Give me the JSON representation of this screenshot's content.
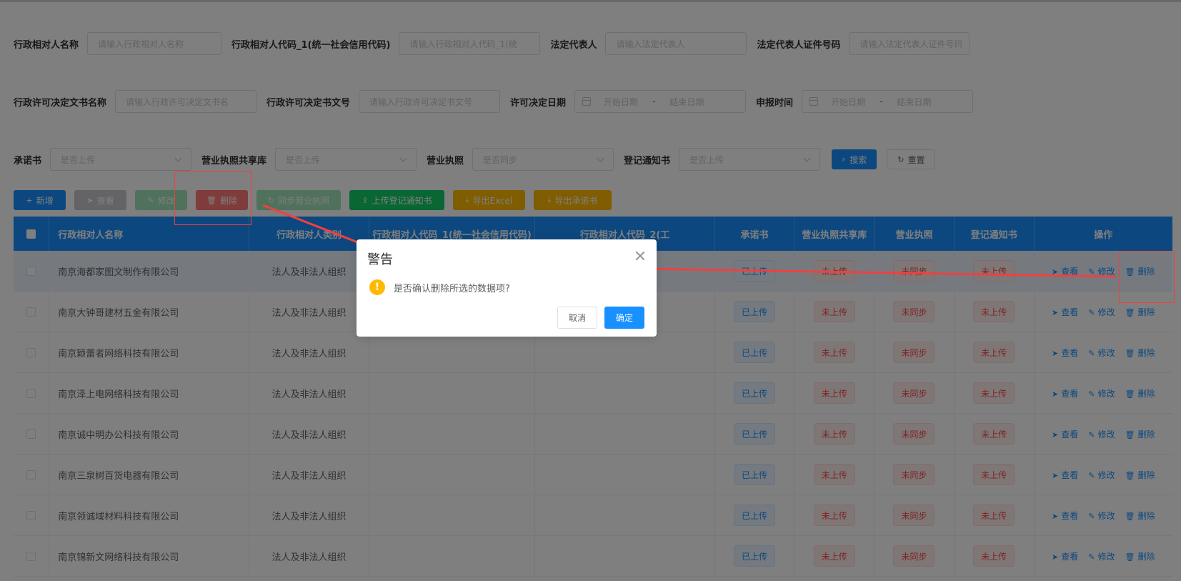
{
  "search_form": {
    "row1": [
      {
        "label": "行政相对人名称",
        "placeholder": "请输入行政相对人名称"
      },
      {
        "label": "行政相对人代码_1(统一社会信用代码)",
        "placeholder": "请输入行政相对人代码_1(统"
      },
      {
        "label": "法定代表人",
        "placeholder": "请输入法定代表人"
      },
      {
        "label": "法定代表人证件号码",
        "placeholder": "请输入法定代表人证件号码"
      }
    ],
    "row2": {
      "doc_name_label": "行政许可决定文书名称",
      "doc_name_placeholder": "请输入行政许可决定文书名",
      "doc_no_label": "行政许可决定书文号",
      "doc_no_placeholder": "请输入行政许可决定书文号",
      "decision_date_label": "许可决定日期",
      "report_time_label": "申报时间",
      "start_placeholder": "开始日期",
      "end_placeholder": "结束日期",
      "range_separator": "-"
    },
    "row3": {
      "commitment_label": "承诺书",
      "commitment_value": "是否上传",
      "shared_label": "营业执照共享库",
      "shared_value": "是否上传",
      "license_label": "营业执照",
      "license_value": "是否同步",
      "notice_label": "登记通知书",
      "notice_value": "是否上传",
      "search_btn": "搜索",
      "reset_btn": "重置"
    }
  },
  "toolbar": {
    "add": "新增",
    "view": "查看",
    "edit": "修改",
    "delete": "删除",
    "sync": "同步营业执照",
    "upload_notice": "上传登记通知书",
    "export_excel": "导出Excel",
    "export_commitment": "导出承诺书"
  },
  "table": {
    "headers": {
      "name": "行政相对人名称",
      "category": "行政相对人类别",
      "code1": "行政相对人代码_1(统一社会信用代码)",
      "code2": "行政相对人代码_2(工",
      "commitment": "承诺书",
      "shared": "营业执照共享库",
      "license": "营业执照",
      "notice": "登记通知书",
      "ops": "操作"
    },
    "op_labels": {
      "view": "查看",
      "edit": "修改",
      "delete": "删除"
    },
    "status_labels": {
      "uploaded": "已上传",
      "not_uploaded": "未上传",
      "not_synced": "未同步"
    },
    "rows": [
      {
        "name": "南京海都家图文制作有限公司",
        "category": "法人及非法人组织"
      },
      {
        "name": "南京大钟哥建材五金有限公司",
        "category": "法人及非法人组织"
      },
      {
        "name": "南京颖蕾者网络科技有限公司",
        "category": "法人及非法人组织"
      },
      {
        "name": "南京泽上电网络科技有限公司",
        "category": "法人及非法人组织"
      },
      {
        "name": "南京诚中明办公科技有限公司",
        "category": "法人及非法人组织"
      },
      {
        "name": "南京三泉树百货电器有限公司",
        "category": "法人及非法人组织"
      },
      {
        "name": "南京领诚域材料科技有限公司",
        "category": "法人及非法人组织"
      },
      {
        "name": "南京锦新文网络科技有限公司",
        "category": "法人及非法人组织"
      }
    ]
  },
  "dialog": {
    "title": "警告",
    "message": "是否确认删除所选的数据项?",
    "cancel": "取消",
    "confirm": "确定"
  },
  "colors": {
    "primary": "#1890ff",
    "danger": "#ff4949",
    "warning": "#ffba00",
    "success": "#13ce66",
    "annotation": "#f04040"
  }
}
